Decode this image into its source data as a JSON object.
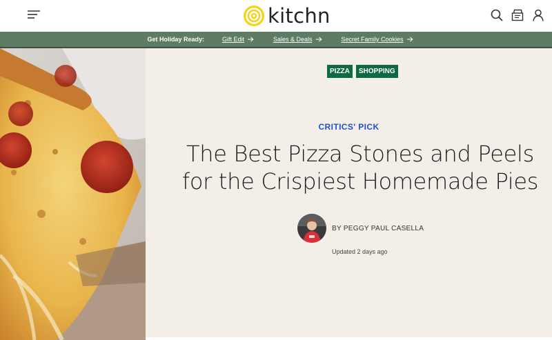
{
  "header": {
    "logo_text": "kitchn",
    "icons": [
      "menu-icon",
      "search-icon",
      "recipe-box-icon",
      "account-icon"
    ]
  },
  "promo": {
    "lead": "Get Holiday Ready:",
    "links": [
      {
        "label": "Gift Edit"
      },
      {
        "label": "Sales & Deals"
      },
      {
        "label": "Secret Family Cookies"
      }
    ]
  },
  "article": {
    "tags": [
      "PIZZA",
      "SHOPPING"
    ],
    "kicker": "CRITICS' PICK",
    "title_line1": "The Best Pizza Stones and Peels",
    "title_line2": "for the Crispiest Homemade Pies",
    "author": "BY PEGGY PAUL CASELLA",
    "updated": "Updated 2 days ago"
  },
  "colors": {
    "promo_bar": "#5e7b63",
    "tag_bg": "#0e6a43",
    "kicker": "#2151c9",
    "hero_panel": "#f3efe8",
    "logo_yellow": "#f6d21b"
  }
}
